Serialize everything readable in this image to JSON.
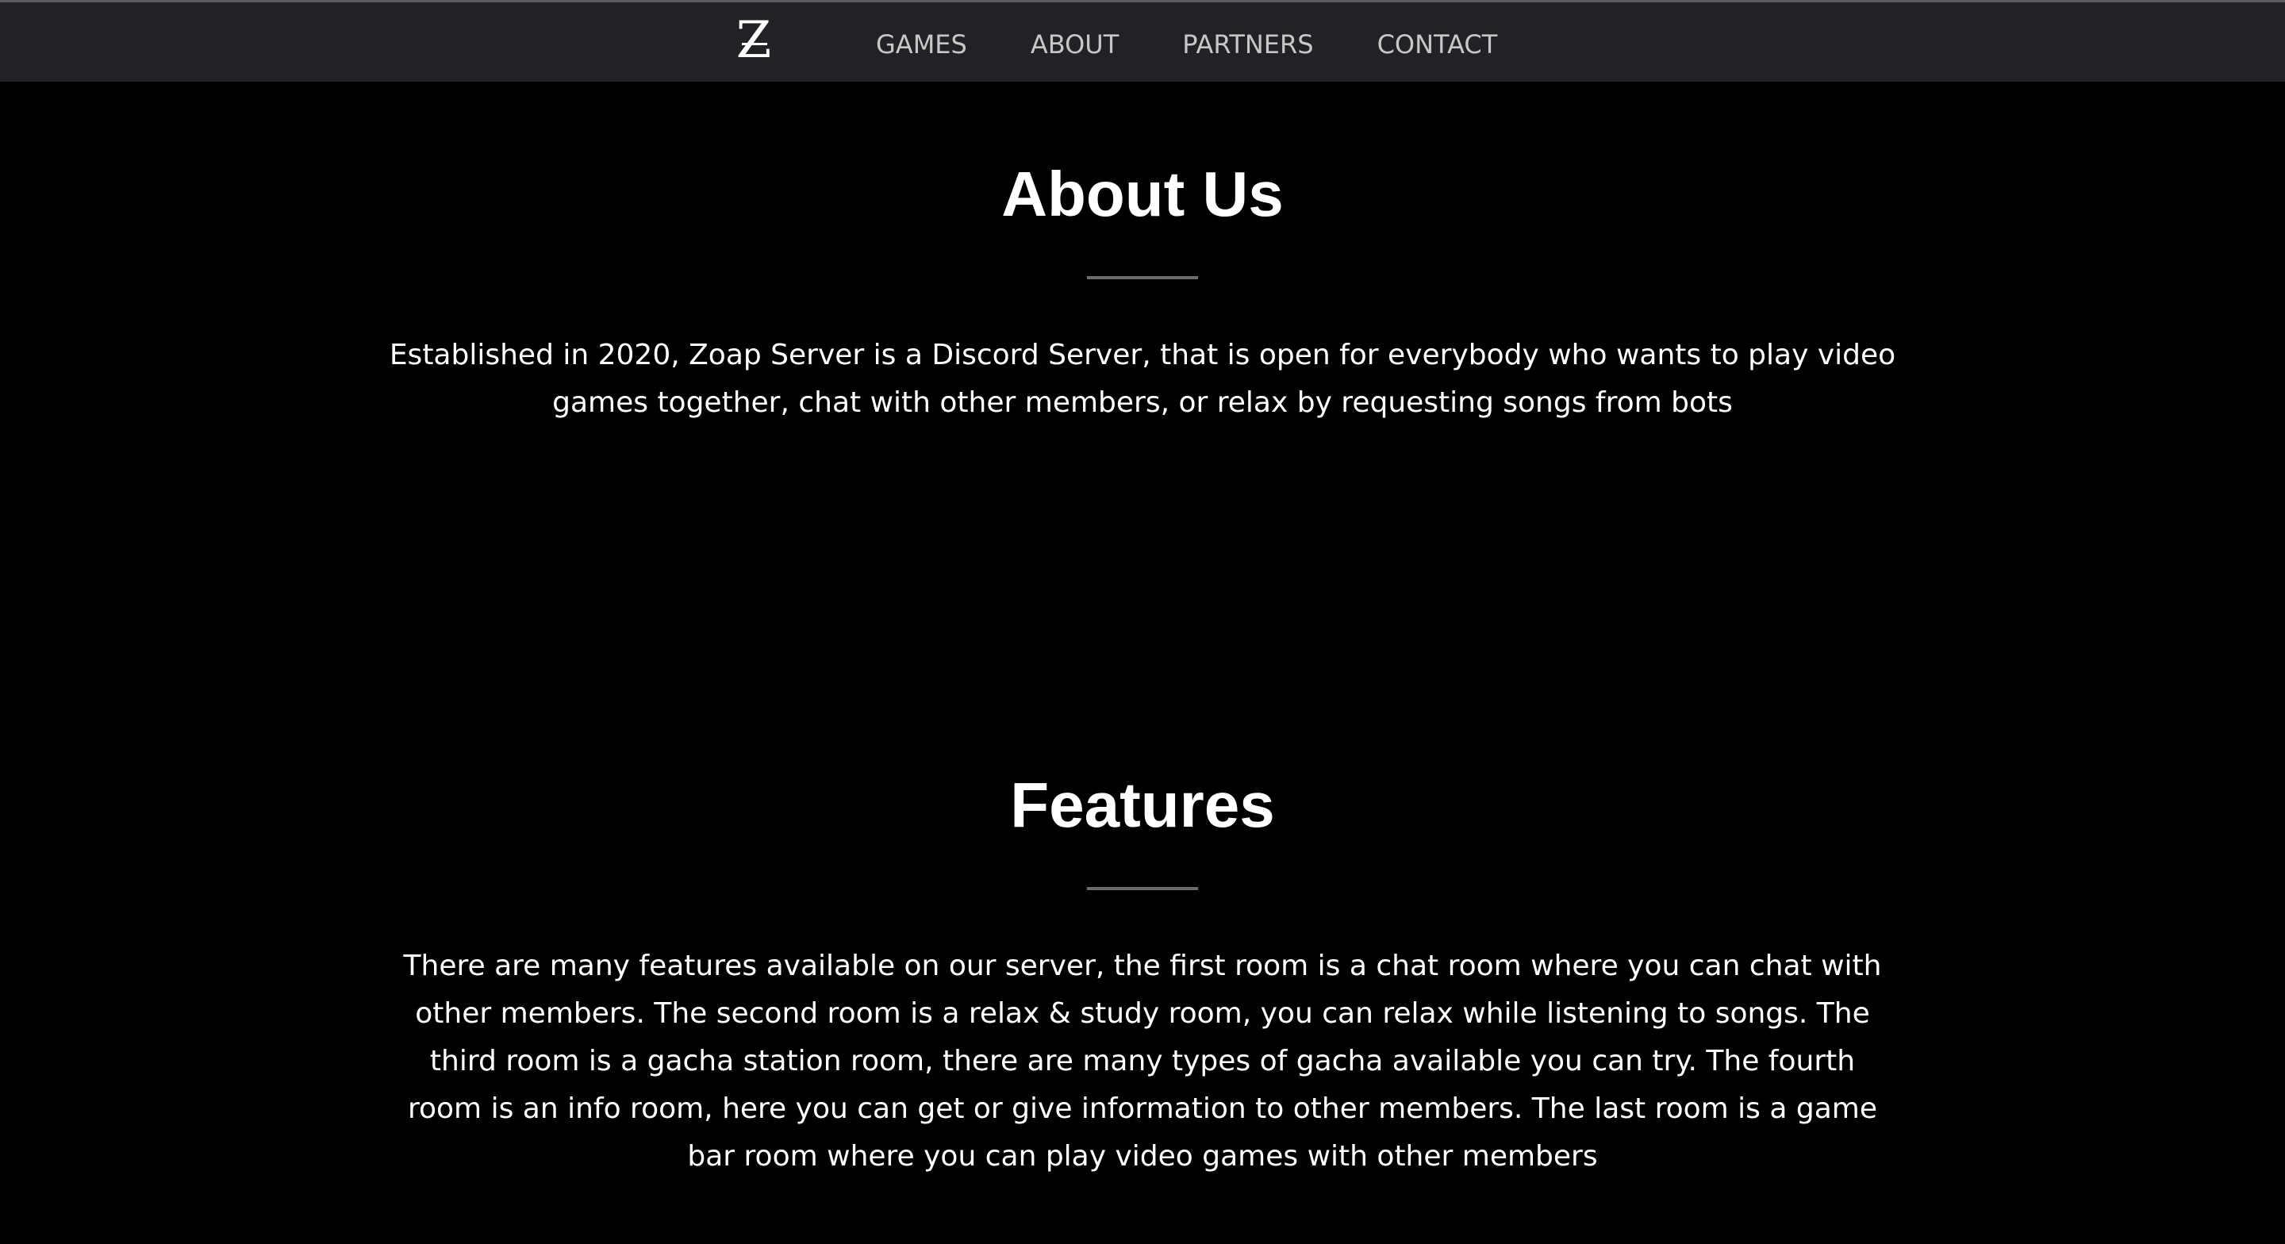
{
  "nav": {
    "logo_letter": "Z",
    "items": [
      {
        "label": "GAMES"
      },
      {
        "label": "ABOUT"
      },
      {
        "label": "PARTNERS"
      },
      {
        "label": "CONTACT"
      }
    ]
  },
  "about": {
    "title": "About Us",
    "body": "Established in 2020, Zoap Server is a Discord Server, that is open for everybody who wants to play video games together, chat with other members, or relax by requesting songs from bots"
  },
  "features": {
    "title": "Features",
    "body": "There are many features available on our server, the first room is a chat room where you can chat with other members. The second room is a relax & study room, you can relax while listening to songs. The third room is a gacha station room, there are many types of gacha available you can try. The fourth room is an info room, here you can get or give information to other members. The last room is a game bar room where you can play video games with other members"
  },
  "colors": {
    "background": "#000000",
    "navbar": "#212225",
    "nav_text": "#c7c7c7",
    "text": "#ffffff",
    "divider": "#6b6b6b"
  }
}
